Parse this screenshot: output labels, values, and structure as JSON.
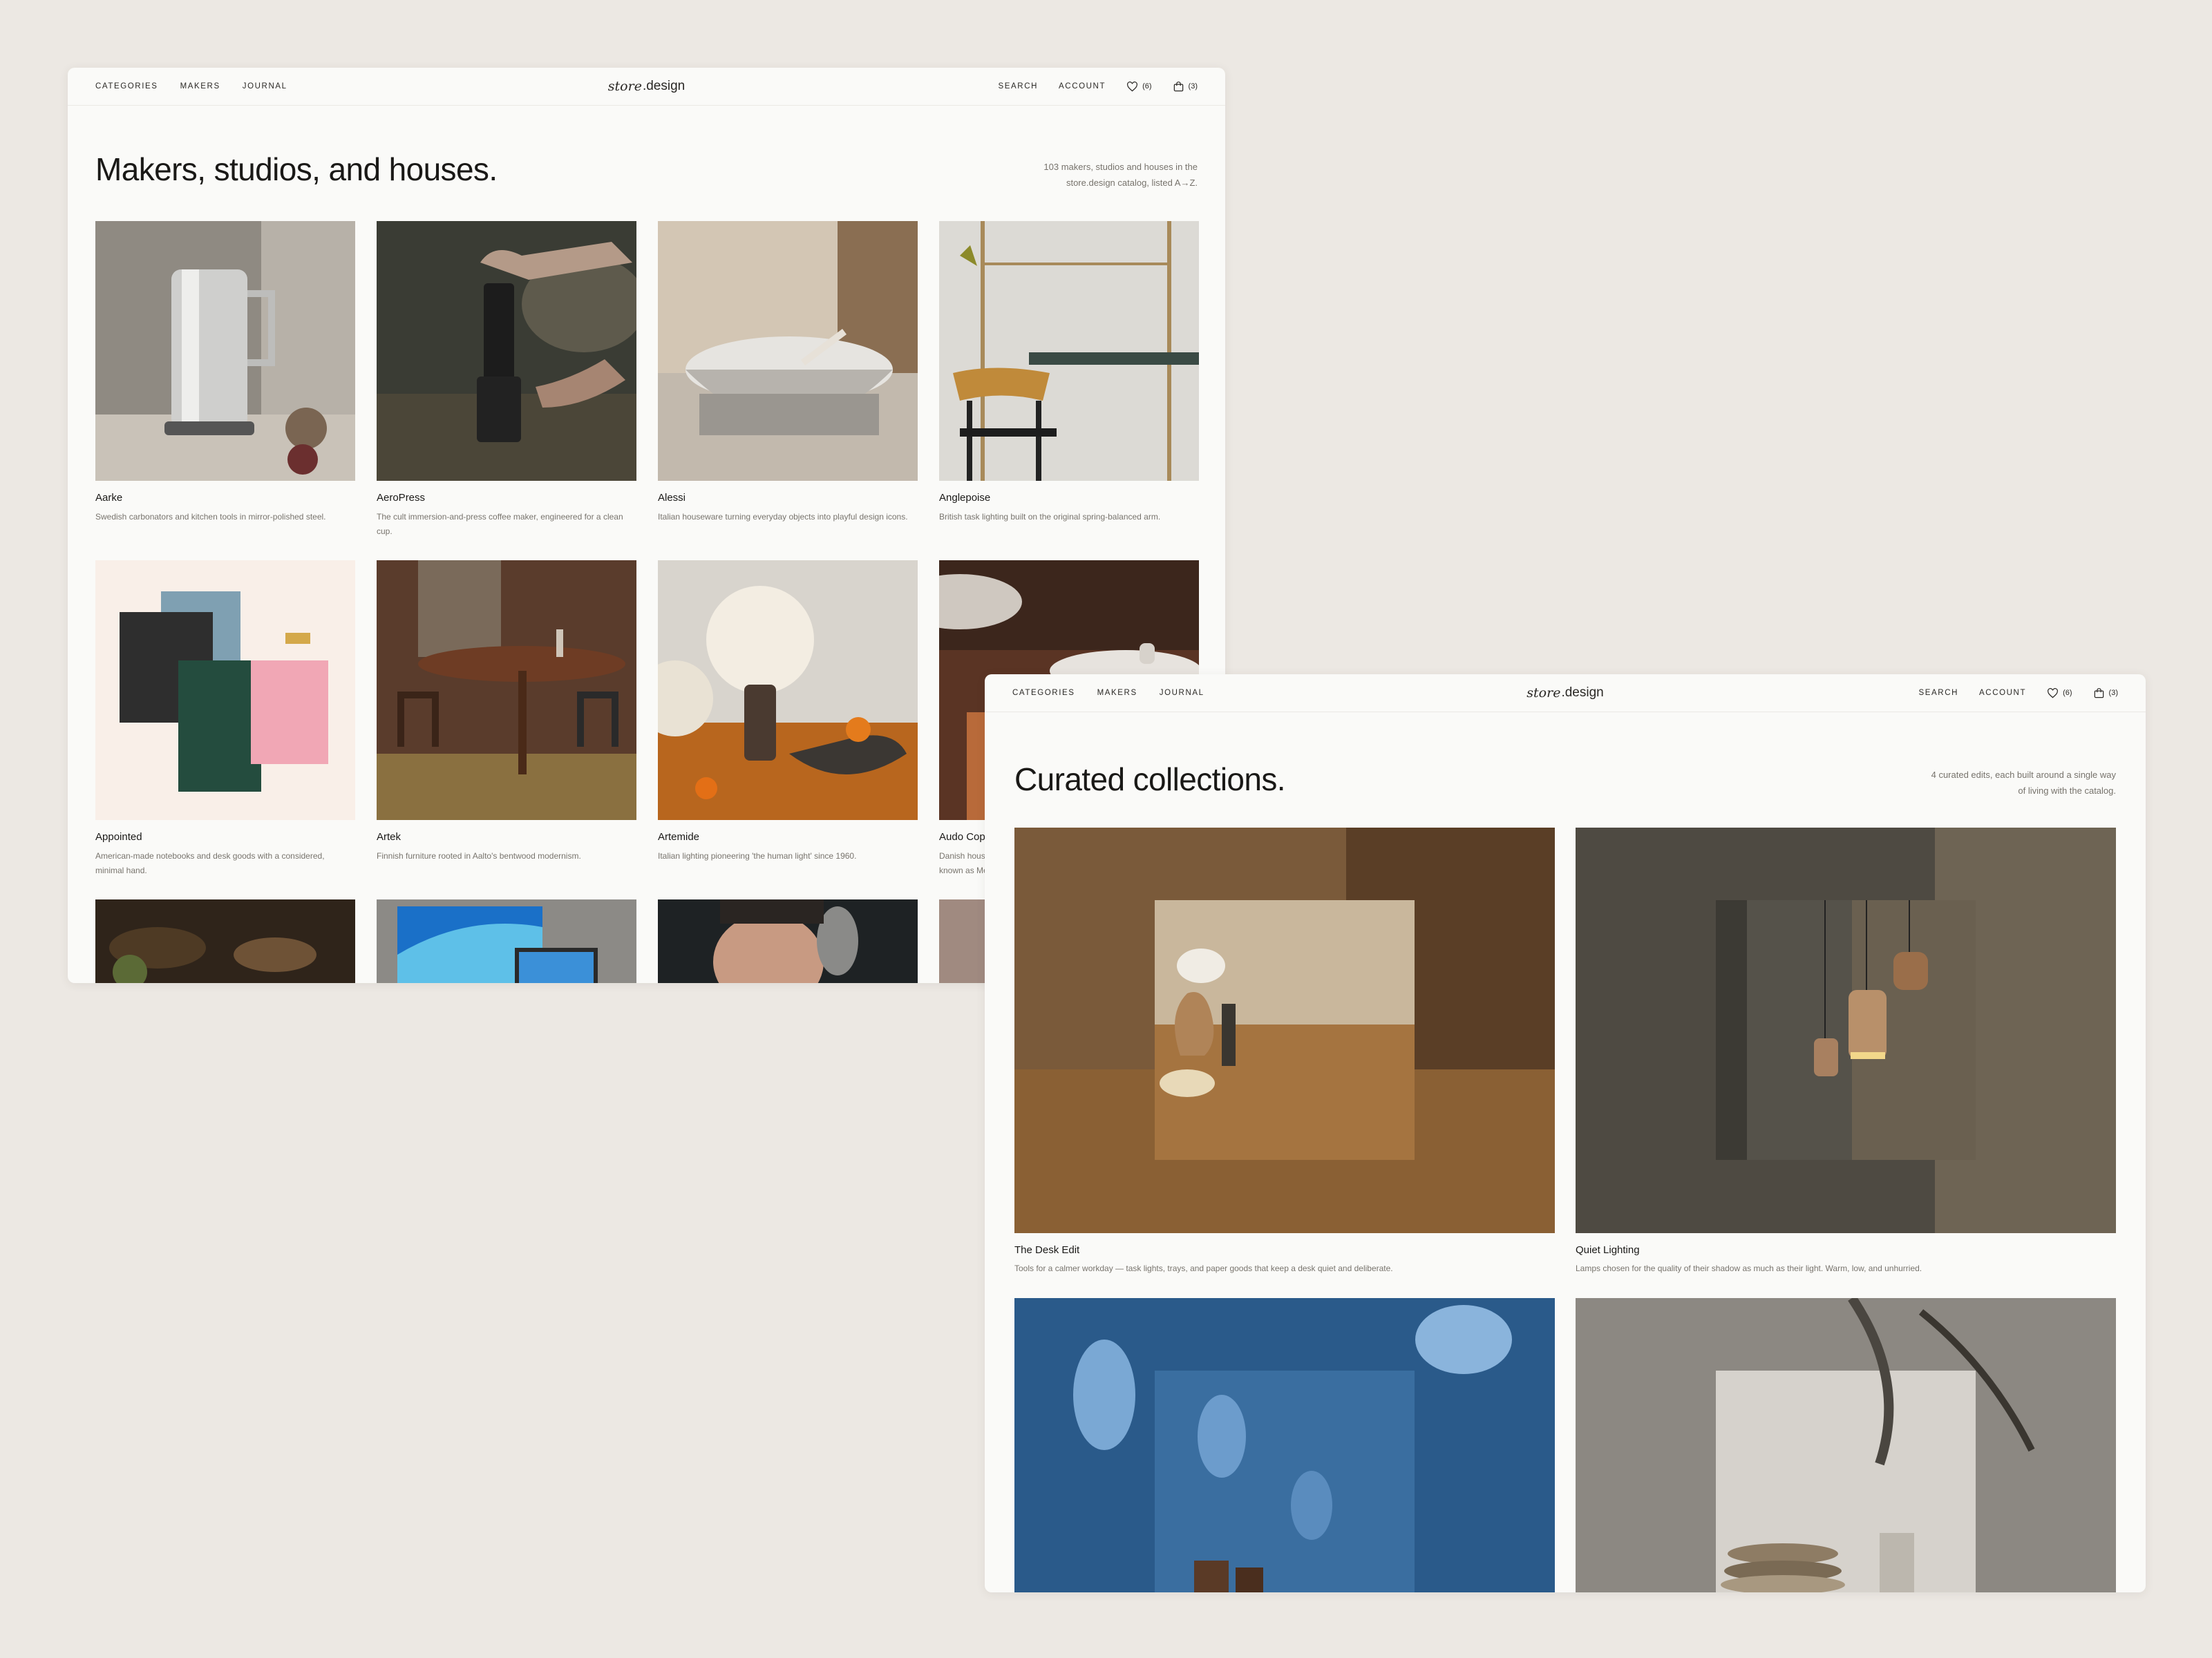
{
  "nav": {
    "categories": "CATEGORIES",
    "makers": "MAKERS",
    "journal": "JOURNAL",
    "logo_script": "store",
    "logo_suffix": ".design",
    "search": "SEARCH",
    "account": "ACCOUNT",
    "wishlist_count": "(6)",
    "cart_count": "(3)"
  },
  "makers_page": {
    "title": "Makers, studios, and houses.",
    "subtitle_line1": "103 makers, studios and houses in the",
    "subtitle_line2": "store.design catalog, listed A→Z.",
    "makers": [
      {
        "name": "Aarke",
        "description": "Swedish carbonators and kitchen tools in mirror-polished steel."
      },
      {
        "name": "AeroPress",
        "description": "The cult immersion-and-press coffee maker, engineered for a clean cup."
      },
      {
        "name": "Alessi",
        "description": "Italian houseware turning everyday objects into playful design icons."
      },
      {
        "name": "Anglepoise",
        "description": "British task lighting built on the original spring-balanced arm."
      },
      {
        "name": "Appointed",
        "description": "American-made notebooks and desk goods with a considered, minimal hand."
      },
      {
        "name": "Artek",
        "description": "Finnish furniture rooted in Aalto's bentwood modernism."
      },
      {
        "name": "Artemide",
        "description": "Italian lighting pioneering 'the human light' since 1960."
      },
      {
        "name": "Audo Copenhagen",
        "description": "Danish house formerly known as Menu."
      }
    ]
  },
  "collections_page": {
    "title": "Curated collections.",
    "subtitle_line1": "4 curated edits, each built around a single way",
    "subtitle_line2": "of living with the catalog.",
    "collections": [
      {
        "name": "The Desk Edit",
        "description": "Tools for a calmer workday — task lights, trays, and paper goods that keep a desk quiet and deliberate."
      },
      {
        "name": "Quiet Lighting",
        "description": "Lamps chosen for the quality of their shadow as much as their light. Warm, low, and unhurried."
      },
      {
        "name": "",
        "description": ""
      },
      {
        "name": "",
        "description": ""
      }
    ]
  }
}
